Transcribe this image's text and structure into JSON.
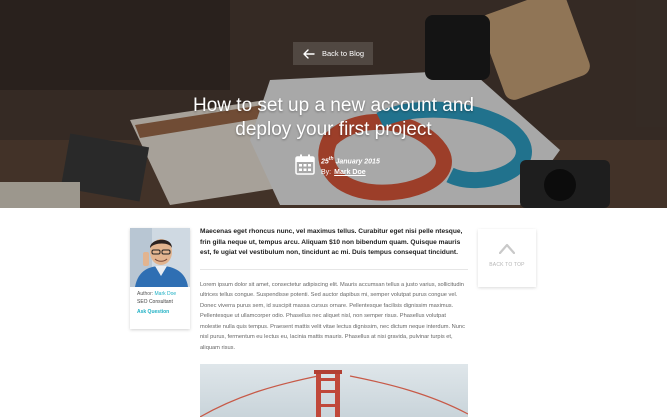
{
  "hero": {
    "back_label": "Back to Blog",
    "title_line1": "How to set up a new account and",
    "title_line2": "deploy your first project",
    "date_day": "25",
    "date_suffix": "th",
    "date_rest": " January 2015",
    "by_label": "By:",
    "author": "Mark Doe"
  },
  "author_card": {
    "author_label": "Author:",
    "author_name": "Mark Doe",
    "role": "SEO Consultant",
    "ask_label": "Ask Question"
  },
  "article": {
    "lead": "Maecenas eget rhoncus nunc, vel maximus tellus. Curabitur eget nisi pelle ntesque, frin gilla neque ut, tempus arcu. Aliquam $10 non bibendum quam. Quisque mauris est, fe ugiat vel vestibulum non, tincidunt ac mi. Duis tempus consequat tincidunt.",
    "body": "Lorem ipsum dolor sit amet, consectetur adipiscing elit. Mauris accumsan tellus a justo varius, sollicitudin ultrices tellus congue. Suspendisse potenti. Sed auctor dapibus mi, semper volutpat purus congue vel. Donec viverra purus sem, id suscipit massa cursus ornare. Pellentesque facilisis dignissim maximus. Pellentesque ut ullamcorper odio. Phasellus nec aliquet nisl, non semper risus. Phasellus volutpat molestie nulla quis tempus. Praesent mattis velit vitae lectus dignissim, nec dictum neque interdum. Nunc nisl purus, fermentum eu lectus eu, lacinia mattis mauris. Phasellus at nisi gravida, pulvinar turpis et, aliquam risus."
  },
  "back_to_top": {
    "label": "BACK TO TOP"
  },
  "icons": {
    "back": "arrow-left-icon",
    "calendar": "calendar-icon",
    "top": "chevron-up-icon"
  },
  "colors": {
    "accent": "#1fb0c4"
  }
}
